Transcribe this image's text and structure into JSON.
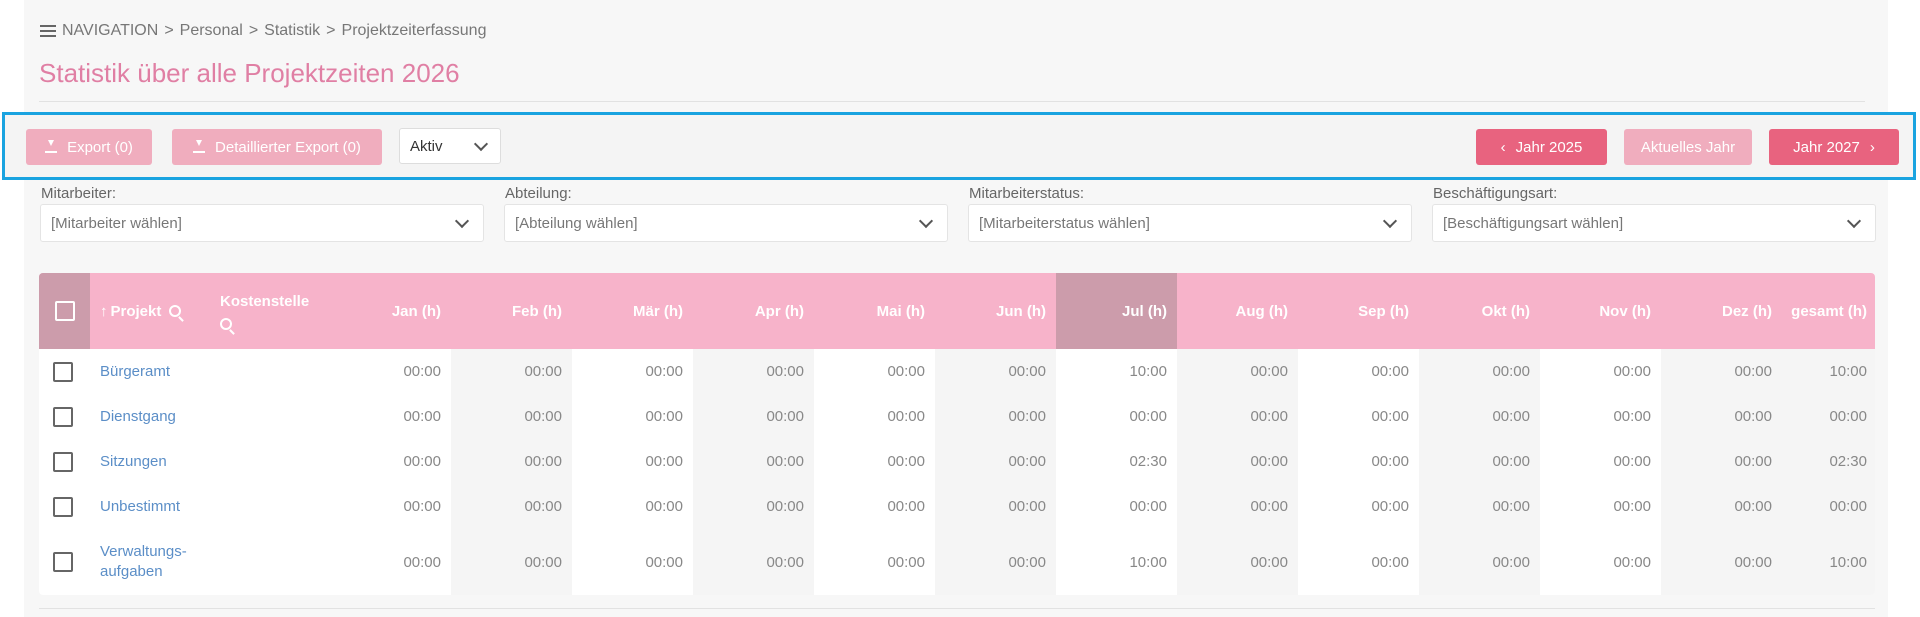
{
  "breadcrumb": {
    "nav_label": "NAVIGATION",
    "items": [
      "Personal",
      "Statistik",
      "Projektzeiterfassung"
    ],
    "separator": ">"
  },
  "page_title": "Statistik über alle Projektzeiten 2026",
  "toolbar": {
    "export_label": "Export (0)",
    "detailed_export_label": "Detaillierter Export (0)",
    "status_select_value": "Aktiv",
    "prev_year_label": "Jahr 2025",
    "current_year_label": "Aktuelles Jahr",
    "next_year_label": "Jahr 2027"
  },
  "filters": [
    {
      "label": "Mitarbeiter:",
      "placeholder": "[Mitarbeiter wählen]"
    },
    {
      "label": "Abteilung:",
      "placeholder": "[Abteilung wählen]"
    },
    {
      "label": "Mitarbeiterstatus:",
      "placeholder": "[Mitarbeiterstatus wählen]"
    },
    {
      "label": "Beschäftigungsart:",
      "placeholder": "[Beschäftigungsart wählen]"
    }
  ],
  "table": {
    "headers": {
      "project": "Projekt",
      "cost_center": "Kostenstelle",
      "months": [
        "Jan (h)",
        "Feb (h)",
        "Mär (h)",
        "Apr (h)",
        "Mai (h)",
        "Jun (h)",
        "Jul (h)",
        "Aug (h)",
        "Sep (h)",
        "Okt (h)",
        "Nov (h)",
        "Dez (h)"
      ],
      "total": "gesamt (h)"
    },
    "rows": [
      {
        "project": [
          "Bürgeramt"
        ],
        "values": [
          "00:00",
          "00:00",
          "00:00",
          "00:00",
          "00:00",
          "00:00",
          "10:00",
          "00:00",
          "00:00",
          "00:00",
          "00:00",
          "00:00"
        ],
        "total": "10:00"
      },
      {
        "project": [
          "Dienstgang"
        ],
        "values": [
          "00:00",
          "00:00",
          "00:00",
          "00:00",
          "00:00",
          "00:00",
          "00:00",
          "00:00",
          "00:00",
          "00:00",
          "00:00",
          "00:00"
        ],
        "total": "00:00"
      },
      {
        "project": [
          "Sitzungen"
        ],
        "values": [
          "00:00",
          "00:00",
          "00:00",
          "00:00",
          "00:00",
          "00:00",
          "02:30",
          "00:00",
          "00:00",
          "00:00",
          "00:00",
          "00:00"
        ],
        "total": "02:30"
      },
      {
        "project": [
          "Unbestimmt"
        ],
        "values": [
          "00:00",
          "00:00",
          "00:00",
          "00:00",
          "00:00",
          "00:00",
          "00:00",
          "00:00",
          "00:00",
          "00:00",
          "00:00",
          "00:00"
        ],
        "total": "00:00"
      },
      {
        "project": [
          "Verwaltungs-",
          "aufgaben"
        ],
        "values": [
          "00:00",
          "00:00",
          "00:00",
          "00:00",
          "00:00",
          "00:00",
          "10:00",
          "00:00",
          "00:00",
          "00:00",
          "00:00",
          "00:00"
        ],
        "total": "10:00"
      }
    ]
  },
  "colors": {
    "accent": "#e8637f",
    "accent_light": "#f0adbe",
    "header_bg": "#f7b3ca",
    "highlight_month_bg": "#cc9cab",
    "title": "#e07fa4",
    "link": "#5b8ec7",
    "focus_border": "#1aa3e0"
  },
  "icons": {
    "menu": "hamburger-icon",
    "export": "download-icon",
    "sort": "sort-up-arrow-icon",
    "search": "search-icon",
    "dropdown": "chevron-down-icon",
    "prev": "chevron-left-icon",
    "next": "chevron-right-icon"
  }
}
